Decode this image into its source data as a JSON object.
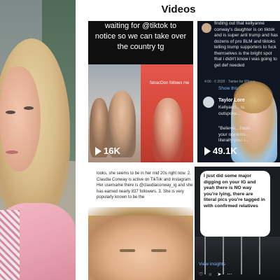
{
  "panel": {
    "title": "Videos"
  },
  "tiles": [
    {
      "caption_lines": [
        "waiting for @tiktok to",
        "notice so we can take over",
        "the country tg"
      ],
      "overlay_text": "fatracOon follows me",
      "views": "16K"
    },
    {
      "comment_text": "finding out that kellyanne conway's daughter is on tiktok and is super anti trump and has dozens of pro BLM and tiktoks telling trump supporters to fuck themselves is the bright spot that i didn't know i was going to get def needed",
      "meta": "4:06 · 6 2020 · Twitter for iPhone",
      "show_thread": "Show this thread",
      "reply_user": "Taylor Lore",
      "reply_text": "Kellyann... is outspoke...",
      "reply_text2": "\"Believe... have your opinions... literally your i...",
      "views": "49.1K"
    },
    {
      "article_text": "looks, she seems to be in her mid 20s right now. 2. Claudia Conway is active on TikTok and Instagram. Her username there is @claudiaconway_ig and she has earned nearly 837 followers. 3. She is very popularly known to be the"
    },
    {
      "bubble_text": "I just did some major digging on your IG and yeah there is NO way you're lying, there are literal pics you're tagged in with confirmed relatives",
      "view_insights": "View insights",
      "action_icons": "♡ ○ ➤ ⋯"
    }
  ]
}
